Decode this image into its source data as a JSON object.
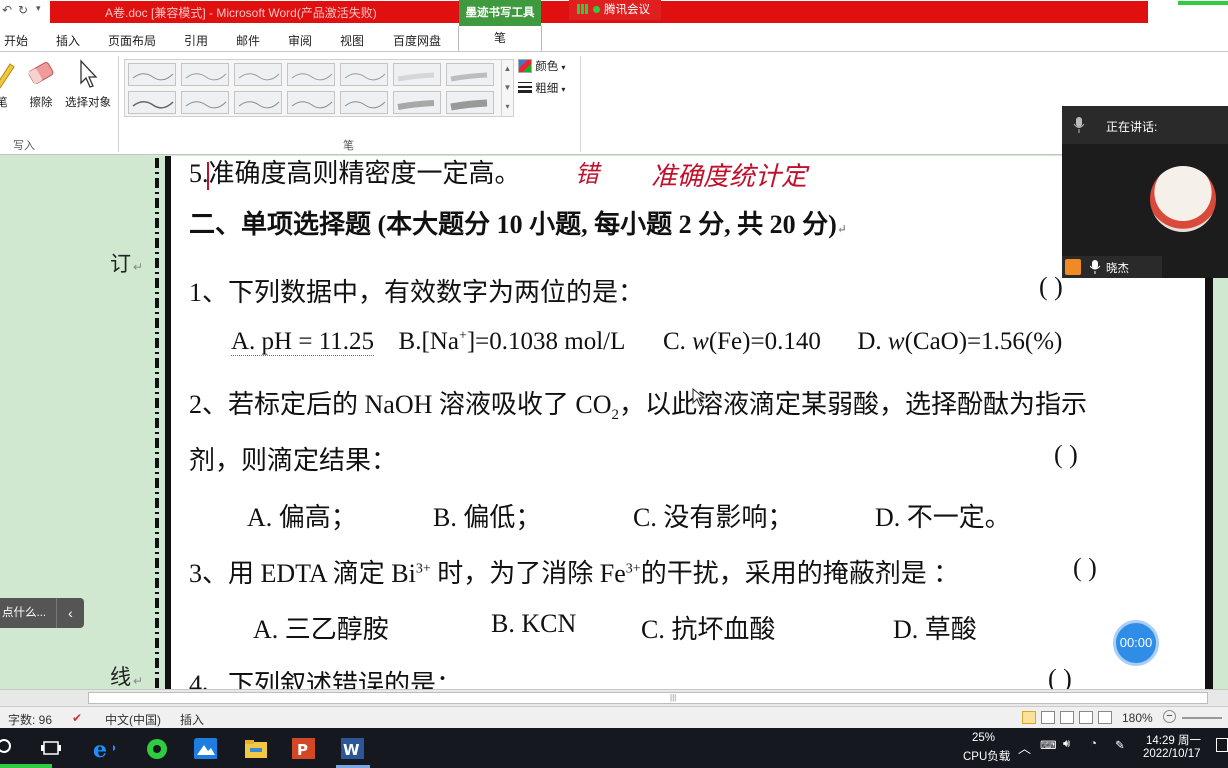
{
  "window": {
    "title": "A卷.doc [兼容模式] - Microsoft Word(产品激活失败)",
    "context_tab_title": "墨迹书写工具",
    "meeting_badge": "腾讯会议"
  },
  "tabs": [
    "开始",
    "插入",
    "页面布局",
    "引用",
    "邮件",
    "审阅",
    "视图",
    "百度网盘",
    "笔"
  ],
  "ribbon": {
    "tools": {
      "pen": "笔",
      "eraser": "擦除",
      "select": "选择对象"
    },
    "group_write": "写入",
    "group_pen": "笔",
    "color_label": "颜色",
    "weight_label": "粗细"
  },
  "margin": {
    "char_top": "订",
    "char_bottom": "线"
  },
  "help": {
    "text": "点什么..."
  },
  "document": {
    "line0": "5.准确度高则精密度一定高。",
    "handwriting1": "错",
    "handwriting2": "准确度统计定",
    "heading": "二、单项选择题 (本大题分 10 小题, 每小题 2 分, 共 20 分)",
    "q1": "1、下列数据中，有效数字为两位的是：",
    "q1_paren": "(          )",
    "q1_a": "A. pH = 11.25",
    "q1_b": "B.[Na",
    "q1_b_sup": "+",
    "q1_b2": "]=0.1038 mol/L",
    "q1_c_pre": "C. ",
    "q1_c_var": "w",
    "q1_c_post": "(Fe)=0.140",
    "q1_d_pre": "D. ",
    "q1_d_var": "w",
    "q1_d_post": "(CaO)=1.56(%)",
    "q2_l1a": "2、若标定后的 NaOH 溶液吸收了 CO",
    "q2_sub": "2",
    "q2_l1b": "，以此溶液滴定某弱酸，选择酚酞为指示",
    "q2_l2": "剂，则滴定结果：",
    "q2_paren": "(          )",
    "q2_a": "A.  偏高；",
    "q2_b": "B.  偏低；",
    "q2_c": "C.  没有影响；",
    "q2_d": "D.  不一定。",
    "q3_a1": "3、用 EDTA 滴定 Bi",
    "q3_sup1": "3+",
    "q3_a2": " 时，为了消除 Fe",
    "q3_sup2": "3+",
    "q3_a3": "的干扰，采用的掩蔽剂是 ：",
    "q3_paren": "(          )",
    "q3_opt_a": "A.  三乙醇胺",
    "q3_opt_b": "B. KCN",
    "q3_opt_c": "C.    抗坏血酸",
    "q3_opt_d": "D.  草酸",
    "q4": "4、下列叙述错误的是：",
    "q4_paren": "(          )"
  },
  "status": {
    "word_count": "字数: 96",
    "language": "中文(中国)",
    "mode": "插入",
    "zoom": "180%"
  },
  "taskbar": {
    "cpu_percent": "25%",
    "cpu_label": "CPU负载",
    "time": "14:29 周一",
    "date": "2022/10/17"
  },
  "meeting": {
    "speaking_label": "正在讲话:",
    "participant": "晓杰",
    "timer": "00:00"
  }
}
